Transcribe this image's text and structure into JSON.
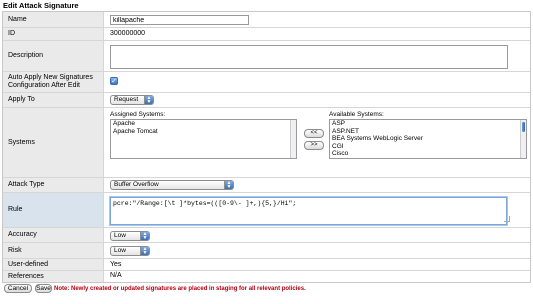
{
  "page_title": "Edit Attack Signature",
  "fields": {
    "name": {
      "label": "Name",
      "value": "killapache"
    },
    "id": {
      "label": "ID",
      "value": "300000000"
    },
    "description": {
      "label": "Description",
      "value": ""
    },
    "auto_apply": {
      "label": "Auto Apply New Signatures Configuration After Edit",
      "checked": true
    },
    "apply_to": {
      "label": "Apply To",
      "selected": "Request"
    },
    "systems": {
      "label": "Systems",
      "assigned_label": "Assigned Systems:",
      "assigned": [
        "Apache",
        "Apache Tomcat"
      ],
      "available_label": "Available Systems:",
      "available": [
        "ASP",
        "ASP.NET",
        "BEA Systems WebLogic Server",
        "CGI",
        "Cisco"
      ],
      "add_button": "<<",
      "remove_button": ">>"
    },
    "attack_type": {
      "label": "Attack Type",
      "selected": "Buffer Overflow"
    },
    "rule": {
      "label": "Rule",
      "value": "pcre:\"/Range:[\\t ]*bytes=(([0-9\\- ]+,){5,}/Hi\";"
    },
    "accuracy": {
      "label": "Accuracy",
      "selected": "Low"
    },
    "risk": {
      "label": "Risk",
      "selected": "Low"
    },
    "user_defined": {
      "label": "User-defined",
      "value": "Yes"
    },
    "references": {
      "label": "References",
      "value": "N/A"
    }
  },
  "footer": {
    "cancel_label": "Cancel",
    "save_label": "Save",
    "note": "Note: Newly created or updated signatures are placed in staging for all relevant policies."
  },
  "icons": {
    "select_arrow": "updown-arrow-icon",
    "checkbox": "checkmark-icon"
  },
  "colors": {
    "accent": "#3a6fb5",
    "note": "#b2000f",
    "label_bg": "#eaeaea",
    "label_highlight": "#d9e3ee"
  }
}
